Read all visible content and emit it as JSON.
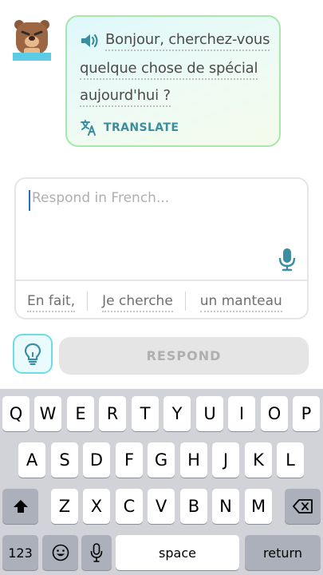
{
  "bubble": {
    "line1": "Bonjour, cherchez-vous",
    "line2": "quelque chose de spécial",
    "line3": "aujourd'hui ?",
    "translate_label": "TRANSLATE"
  },
  "input": {
    "placeholder": "Respond in French..."
  },
  "suggestions": [
    "En fait,",
    "Je cherche",
    "un manteau"
  ],
  "respond_label": "RESPOND",
  "keyboard": {
    "row1": [
      "Q",
      "W",
      "E",
      "R",
      "T",
      "Y",
      "U",
      "I",
      "O",
      "P"
    ],
    "row2": [
      "A",
      "S",
      "D",
      "F",
      "G",
      "H",
      "J",
      "K",
      "L"
    ],
    "row3": [
      "Z",
      "X",
      "C",
      "V",
      "B",
      "N",
      "M"
    ],
    "numbers_label": "123",
    "space_label": "space",
    "return_label": "return"
  },
  "icons": {
    "speaker": "speaker-icon",
    "translate": "translate-icon",
    "mic": "microphone-icon",
    "hint": "lightbulb-icon",
    "shift": "shift-icon",
    "backspace": "backspace-icon",
    "emoji": "emoji-icon",
    "dictation": "dictation-mic-icon"
  },
  "colors": {
    "accent_teal": "#3b8da0",
    "bubble_border": "#a9e7ac",
    "hint_border": "#6ddbe8",
    "caret": "#2b71b6"
  }
}
